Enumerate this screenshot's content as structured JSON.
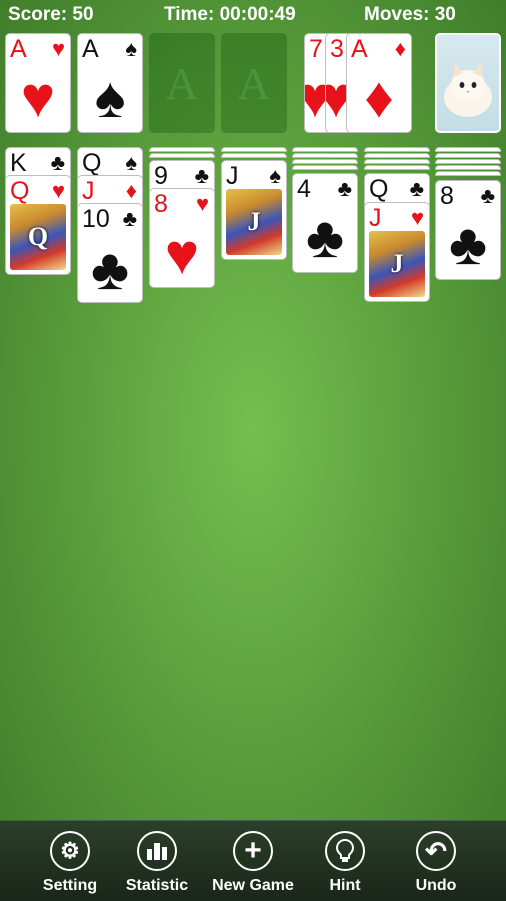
{
  "status": {
    "score": "Score: 50",
    "time": "Time: 00:00:49",
    "moves": "Moves: 30"
  },
  "foundations": [
    {
      "rank": "A",
      "suit": "♥",
      "color": "red"
    },
    {
      "rank": "A",
      "suit": "♠",
      "color": "black"
    },
    {
      "rank": "A",
      "suit": "",
      "color": "empty"
    },
    {
      "rank": "A",
      "suit": "",
      "color": "empty"
    }
  ],
  "waste": [
    {
      "rank": "7",
      "suit": "♥",
      "color": "red"
    },
    {
      "rank": "3",
      "suit": "♥",
      "color": "red"
    },
    {
      "rank": "A",
      "suit": "♦",
      "color": "red"
    }
  ],
  "tableau": {
    "col1": [
      {
        "rank": "K",
        "suit": "♣",
        "color": "black"
      },
      {
        "rank": "Q",
        "suit": "♥",
        "color": "red",
        "face": "Q"
      }
    ],
    "col2": [
      {
        "rank": "Q",
        "suit": "♠",
        "color": "black"
      },
      {
        "rank": "J",
        "suit": "♦",
        "color": "red"
      },
      {
        "rank": "10",
        "suit": "♣",
        "color": "black"
      }
    ],
    "col3": [
      {
        "rank": "9",
        "suit": "♣",
        "color": "black"
      },
      {
        "rank": "8",
        "suit": "♥",
        "color": "red"
      }
    ],
    "col4": [
      {
        "rank": "J",
        "suit": "♠",
        "color": "black",
        "face": "J"
      }
    ],
    "col5": [
      {
        "rank": "4",
        "suit": "♣",
        "color": "black"
      }
    ],
    "col6": [
      {
        "rank": "Q",
        "suit": "♣",
        "color": "black"
      },
      {
        "rank": "J",
        "suit": "♥",
        "color": "red",
        "face": "J"
      }
    ],
    "col7": [
      {
        "rank": "8",
        "suit": "♣",
        "color": "black"
      }
    ]
  },
  "toolbar": {
    "setting": {
      "label": "Setting",
      "icon": "⚙"
    },
    "statistic": {
      "label": "Statistic",
      "icon": "▮"
    },
    "new_game": {
      "label": "New Game",
      "icon": "+"
    },
    "hint": {
      "label": "Hint",
      "icon": "?"
    },
    "undo": {
      "label": "Undo",
      "icon": "↶"
    }
  },
  "colors": {
    "felt": "#5ea43f",
    "red_suit": "#e8121b",
    "toolbar": "#1f2d1e"
  }
}
